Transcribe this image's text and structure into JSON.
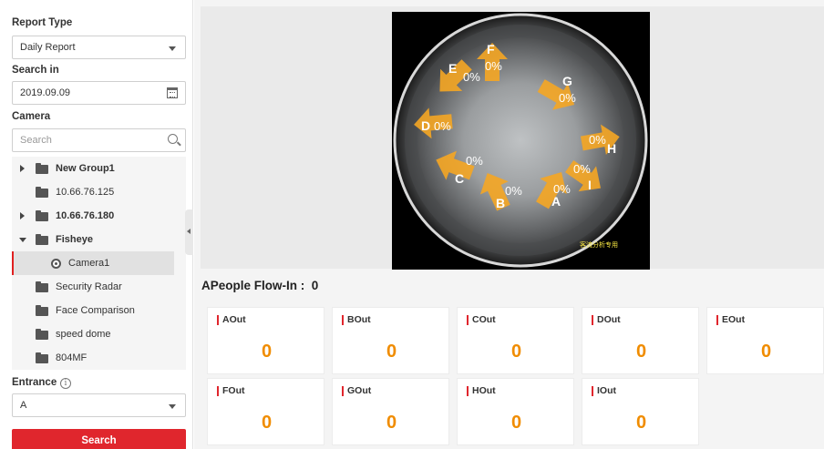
{
  "left_panel": {
    "report_type_label": "Report Type",
    "report_type_value": "Daily Report",
    "search_in_label": "Search in",
    "date_value": "2019.09.09",
    "camera_label": "Camera",
    "camera_search_placeholder": "Search",
    "tree": [
      {
        "label": "New Group1",
        "expanded": false,
        "bold": true
      },
      {
        "label": "10.66.76.125",
        "bold": false
      },
      {
        "label": "10.66.76.180",
        "expanded": false,
        "bold": true
      },
      {
        "label": "Fisheye",
        "expanded": true,
        "bold": true
      },
      {
        "label": "Camera1​",
        "selected": true
      },
      {
        "label": "Security Radar"
      },
      {
        "label": "Face Comparison"
      },
      {
        "label": "speed dome"
      },
      {
        "label": "804MF"
      }
    ],
    "entrance_label": "Entrance",
    "entrance_value": "A",
    "search_button": "Search"
  },
  "video": {
    "zones": [
      {
        "letter": "A",
        "pct": "0%"
      },
      {
        "letter": "B",
        "pct": "0%"
      },
      {
        "letter": "C",
        "pct": "0%"
      },
      {
        "letter": "D",
        "pct": "0%"
      },
      {
        "letter": "E",
        "pct": "0%"
      },
      {
        "letter": "F",
        "pct": "0%"
      },
      {
        "letter": "G",
        "pct": "0%"
      },
      {
        "letter": "H",
        "pct": "0%"
      },
      {
        "letter": "I",
        "pct": "0%"
      }
    ],
    "overlay_text": "客流分析专用",
    "arrow_color": "#f5a623"
  },
  "flow": {
    "title": "APeople Flow-In :  0",
    "cards": [
      {
        "label": "AOut",
        "value": "0"
      },
      {
        "label": "BOut",
        "value": "0"
      },
      {
        "label": "COut",
        "value": "0"
      },
      {
        "label": "DOut",
        "value": "0"
      },
      {
        "label": "EOut",
        "value": "0"
      },
      {
        "label": "FOut",
        "value": "0"
      },
      {
        "label": "GOut",
        "value": "0"
      },
      {
        "label": "HOut",
        "value": "0"
      },
      {
        "label": "IOut",
        "value": "0"
      }
    ]
  },
  "colors": {
    "accent": "#e0262d",
    "value_orange": "#f08c00"
  }
}
